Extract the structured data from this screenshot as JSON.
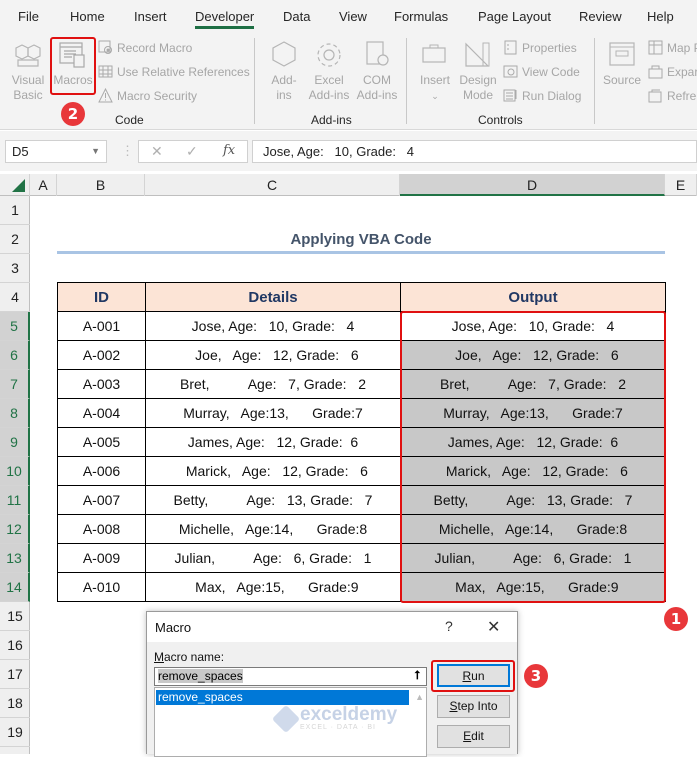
{
  "ribbon": {
    "tabs": [
      "File",
      "Home",
      "Insert",
      "Developer",
      "Data",
      "View",
      "Formulas",
      "Page Layout",
      "Review",
      "Help"
    ],
    "active_tab": "Developer",
    "groups": {
      "code": {
        "label": "Code",
        "visual_basic": "Visual Basic",
        "macros": "Macros",
        "record_macro": "Record Macro",
        "use_relative": "Use Relative References",
        "macro_security": "Macro Security"
      },
      "addins": {
        "label": "Add-ins",
        "addins": "Add-ins",
        "excel_addins": "Excel Add-ins",
        "com_addins": "COM Add-ins"
      },
      "controls": {
        "label": "Controls",
        "insert": "Insert",
        "design_mode": "Design Mode",
        "properties": "Properties",
        "view_code": "View Code",
        "run_dialog": "Run Dialog"
      },
      "xml": {
        "source": "Source",
        "map_properties": "Map P",
        "expansion_packs": "Expar",
        "refresh_data": "Refre"
      }
    }
  },
  "formula_bar": {
    "name_box": "D5",
    "cancel": "✕",
    "enter": "✓",
    "fx": "fx",
    "value": "Jose, Age:   10, Grade:   4"
  },
  "grid": {
    "columns": [
      "A",
      "B",
      "C",
      "D",
      "E"
    ],
    "selected_column": "D",
    "rows": [
      "1",
      "2",
      "3",
      "4",
      "5",
      "6",
      "7",
      "8",
      "9",
      "10",
      "11",
      "12",
      "13",
      "14",
      "15",
      "16",
      "17",
      "18",
      "19"
    ],
    "selected_rows_from": 5,
    "selected_rows_to": 14
  },
  "sheet": {
    "title": "Applying VBA Code",
    "headers": [
      "ID",
      "Details",
      "Output"
    ],
    "rows": [
      {
        "id": "A-001",
        "details": "Jose, Age:   10, Grade:   4",
        "output": "Jose, Age:   10, Grade:   4"
      },
      {
        "id": "A-002",
        "details": "  Joe,   Age:   12, Grade:   6",
        "output": "  Joe,   Age:   12, Grade:   6"
      },
      {
        "id": "A-003",
        "details": "Bret,          Age:   7, Grade:   2",
        "output": "Bret,          Age:   7, Grade:   2"
      },
      {
        "id": "A-004",
        "details": "Murray,   Age:13,      Grade:7",
        "output": "Murray,   Age:13,      Grade:7"
      },
      {
        "id": "A-005",
        "details": "James, Age:   12, Grade:  6",
        "output": "James, Age:   12, Grade:  6"
      },
      {
        "id": "A-006",
        "details": "  Marick,   Age:   12, Grade:   6",
        "output": "  Marick,   Age:   12, Grade:   6"
      },
      {
        "id": "A-007",
        "details": "Betty,          Age:   13, Grade:   7",
        "output": "Betty,          Age:   13, Grade:   7"
      },
      {
        "id": "A-008",
        "details": "Michelle,   Age:14,      Grade:8",
        "output": "Michelle,   Age:14,      Grade:8"
      },
      {
        "id": "A-009",
        "details": "Julian,          Age:   6, Grade:   1",
        "output": "Julian,          Age:   6, Grade:   1"
      },
      {
        "id": "A-010",
        "details": "  Max,   Age:15,      Grade:9",
        "output": "  Max,   Age:15,      Grade:9"
      }
    ]
  },
  "annotations": {
    "step1": "1",
    "step2": "2",
    "step3": "3"
  },
  "dialog": {
    "title": "Macro",
    "help": "?",
    "close": "✕",
    "macro_name_label_prefix": "M",
    "macro_name_label_rest": "acro name:",
    "macro_name_value": "remove_spaces",
    "list_items": [
      "remove_spaces"
    ],
    "buttons": {
      "run_u": "R",
      "run_rest": "un",
      "step_u": "S",
      "step_rest": "tep Into",
      "edit_u": "E",
      "edit_rest": "dit"
    }
  },
  "watermark": {
    "main": "exceldemy",
    "sub": "EXCEL · DATA · BI"
  },
  "colors": {
    "accent_green": "#217346",
    "highlight_red": "#e01010",
    "header_fill": "#fce4d6",
    "selection_gray": "#c8c8c8",
    "list_select": "#0078d7"
  }
}
